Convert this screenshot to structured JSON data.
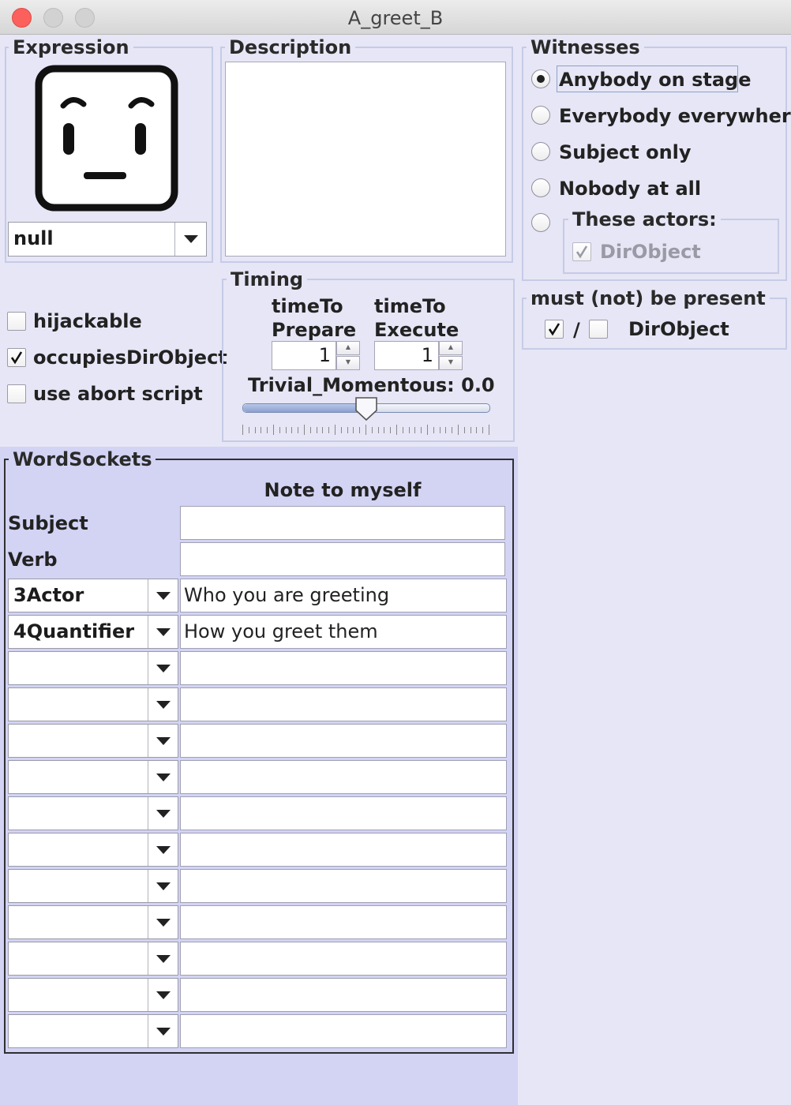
{
  "window": {
    "title": "A_greet_B"
  },
  "expression": {
    "group_title": "Expression",
    "face_icon": "neutral-face-icon",
    "combo_value": "null"
  },
  "description": {
    "group_title": "Description",
    "text": ""
  },
  "options": {
    "hijackable": {
      "label": "hijackable",
      "checked": false
    },
    "occupies_dir_object": {
      "label": "occupiesDirObject",
      "checked": true
    },
    "use_abort_script": {
      "label": "use abort script",
      "checked": false
    }
  },
  "timing": {
    "group_title": "Timing",
    "prepare_label_1": "timeTo",
    "prepare_label_2": "Prepare",
    "execute_label_1": "timeTo",
    "execute_label_2": "Execute",
    "prepare_value": "1",
    "execute_value": "1",
    "slider_label": "Trivial_Momentous: 0.0",
    "slider_level": 0.5
  },
  "witnesses": {
    "group_title": "Witnesses",
    "options": [
      {
        "label": "Anybody on stage",
        "selected": true
      },
      {
        "label": "Everybody everywhere",
        "selected": false
      },
      {
        "label": "Subject only",
        "selected": false
      },
      {
        "label": "Nobody at all",
        "selected": false
      },
      {
        "label": "These actors:",
        "selected": false
      }
    ],
    "these_actors": {
      "item_label": "DirObject",
      "checked": true,
      "disabled": true
    }
  },
  "presence": {
    "group_title": "must (not) be present",
    "separator": "/",
    "must_checked": true,
    "must_not_checked": false,
    "actor_label": "DirObject"
  },
  "word_sockets": {
    "group_title": "WordSockets",
    "note_header": "Note to myself",
    "fixed_rows": [
      {
        "label": "Subject",
        "note": ""
      },
      {
        "label": "Verb",
        "note": ""
      }
    ],
    "socket_rows": [
      {
        "socket": "3Actor",
        "note": "Who you are greeting"
      },
      {
        "socket": "4Quantifier",
        "note": "How you greet them"
      },
      {
        "socket": "",
        "note": ""
      },
      {
        "socket": "",
        "note": ""
      },
      {
        "socket": "",
        "note": ""
      },
      {
        "socket": "",
        "note": ""
      },
      {
        "socket": "",
        "note": ""
      },
      {
        "socket": "",
        "note": ""
      },
      {
        "socket": "",
        "note": ""
      },
      {
        "socket": "",
        "note": ""
      },
      {
        "socket": "",
        "note": ""
      },
      {
        "socket": "",
        "note": ""
      },
      {
        "socket": "",
        "note": ""
      }
    ]
  }
}
